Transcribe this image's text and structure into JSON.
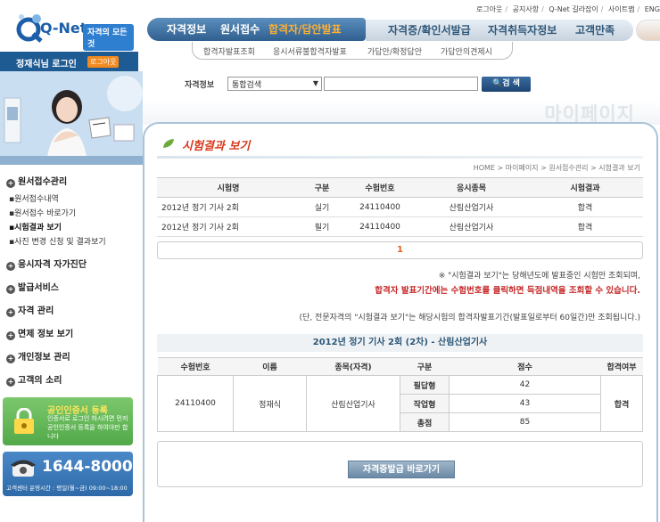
{
  "top_links": [
    "로그아웃",
    "공지사항",
    "Q-Net 길라잡이",
    "사이트맵",
    "ENG"
  ],
  "logo": {
    "text": "Q-Net",
    "slogan": "자격의 모든것"
  },
  "main_nav": {
    "primary": [
      "자격정보",
      "원서접수",
      "합격자/답안발표"
    ],
    "secondary": [
      "자격증/확인서발급",
      "자격취득자정보",
      "고객만족"
    ]
  },
  "sub_nav": [
    "합격자발표조회",
    "응시서류불합격자발표",
    "가답안/확정답안",
    "가답안의견제시"
  ],
  "search": {
    "label": "자격정보",
    "selected": "통합검색",
    "button": "검 색"
  },
  "mypage_title": "마이페이지",
  "user": {
    "login_text": "정재식님 로그인",
    "logout": "로그아웃"
  },
  "left_menu": {
    "sections": [
      "원서접수관리",
      "응시자격 자가진단",
      "발급서비스",
      "자격 관리",
      "면제 정보 보기",
      "개인정보 관리",
      "고객의 소리"
    ],
    "sub_items": [
      "원서접수내역",
      "원서접수 바로가기",
      "시험결과 보기",
      "사진 변경 신청 및 결과보기"
    ],
    "active_sub": "시험결과 보기"
  },
  "cert_promo": {
    "title": "공인인증서 등록",
    "text": "인증서로 로그인 하시려면 먼저 공인인증서 등록을 하여야만 합니다"
  },
  "call_center": {
    "number": "1644-8000",
    "hours": "고객센터 운영시간 : 평일(월~금) 09:00~18:00"
  },
  "page": {
    "title": "시험결과 보기",
    "breadcrumb": "HOME > 마이페이지 > 원서접수관리 > 시험결과 보기"
  },
  "results_table": {
    "headers": [
      "시험명",
      "구분",
      "수험번호",
      "응시종목",
      "시험결과"
    ],
    "rows": [
      [
        "2012년 정기 기사 2회",
        "실기",
        "24110400",
        "산림산업기사",
        "합격"
      ],
      [
        "2012년 정기 기사 2회",
        "필기",
        "24110400",
        "산림산업기사",
        "합격"
      ]
    ]
  },
  "pager": {
    "current": "1"
  },
  "notices": {
    "line1": "※ \"시험결과 보기\"는 당해년도에 발표중인 시험만 조회되며,",
    "line2": "합격자 발표기간에는 수험번호를 클릭하면 득점내역을 조회할 수 있습니다.",
    "line3": "(단, 전문자격의 \"시험결과 보기\"는 해당시험의 합격자발표기간(발표일로부터 60일간)만 조회됩니다.)"
  },
  "detail": {
    "title": "2012년 정기 기사 2회 (2차) - 산림산업기사",
    "headers": [
      "수험번호",
      "이름",
      "종목(자격)",
      "구분",
      "점수",
      "합격여부"
    ],
    "exam_no": "24110400",
    "name": "정재식",
    "subject": "산림산업기사",
    "result": "합격",
    "scores": [
      {
        "label": "필답형",
        "score": "42"
      },
      {
        "label": "작업형",
        "score": "43"
      },
      {
        "label": "총점",
        "score": "85"
      }
    ]
  },
  "issue_button": "자격증발급 바로가기",
  "colors": {
    "nav_blue": "#2f5f8e",
    "active_orange": "#ffb035",
    "alert_red": "#c62828",
    "pager_orange": "#e0641e"
  }
}
